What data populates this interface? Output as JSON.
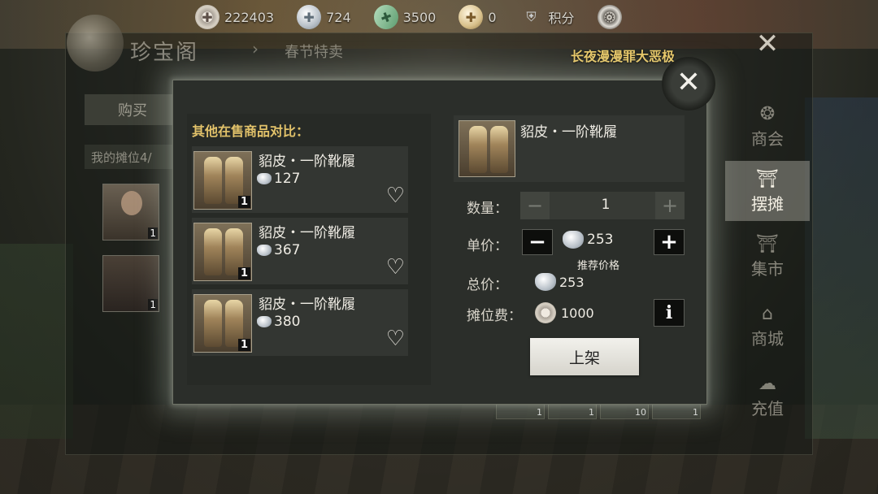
{
  "currencies": [
    {
      "icon": "coin-icon",
      "value": "222403"
    },
    {
      "icon": "silver-ingot-icon",
      "value": "724"
    },
    {
      "icon": "jade-ticket-icon",
      "value": "3500"
    },
    {
      "icon": "gold-ingot-icon",
      "value": "0"
    }
  ],
  "points": {
    "label": "积分"
  },
  "back_panel": {
    "title": "珍宝阁",
    "tab": "春节特卖",
    "notice": "长夜漫漫罪大恶极",
    "buy_label": "购买",
    "stall_label": "我的摊位4/",
    "avatar_count": "1",
    "skirt_count": "1",
    "slot_counts": [
      "1",
      "1",
      "10",
      "1"
    ]
  },
  "side_nav": [
    {
      "label": "商会",
      "icon": "guild-icon",
      "active": false
    },
    {
      "label": "摆摊",
      "icon": "stall-icon",
      "active": true
    },
    {
      "label": "集市",
      "icon": "market-icon",
      "active": false
    },
    {
      "label": "商城",
      "icon": "mall-icon",
      "active": false
    },
    {
      "label": "充值",
      "icon": "recharge-icon",
      "active": false
    }
  ],
  "compare": {
    "title": "其他在售商品对比：",
    "items": [
      {
        "name": "貂皮・一阶靴履",
        "price": "127",
        "count": "1"
      },
      {
        "name": "貂皮・一阶靴履",
        "price": "367",
        "count": "1"
      },
      {
        "name": "貂皮・一阶靴履",
        "price": "380",
        "count": "1"
      }
    ]
  },
  "listing": {
    "item_name": "貂皮・一阶靴履",
    "quantity_label": "数量：",
    "quantity": "1",
    "unit_price_label": "单价：",
    "unit_price": "253",
    "recommend_label": "推荐价格",
    "total_label": "总价：",
    "total": "253",
    "fee_label": "摊位费：",
    "fee": "1000",
    "submit_label": "上架"
  }
}
